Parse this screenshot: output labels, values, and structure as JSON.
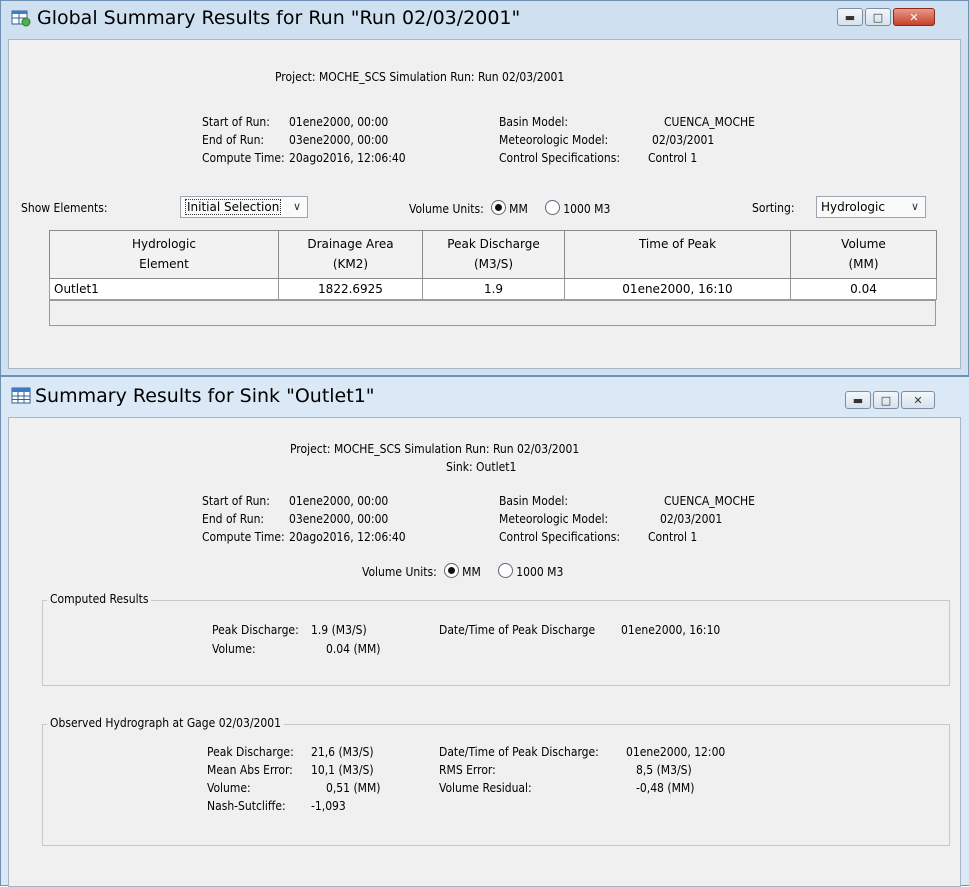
{
  "global": {
    "title": "Global Summary Results for Run \"Run 02/03/2001\"",
    "project_line": "Project: MOCHE_SCS    Simulation Run: Run 02/03/2001",
    "start_of_run_label": "Start of Run:",
    "start_of_run": "01ene2000, 00:00",
    "end_of_run_label": "End of Run:",
    "end_of_run": "03ene2000, 00:00",
    "compute_time_label": "Compute Time:",
    "compute_time": "20ago2016, 12:06:40",
    "basin_model_label": "Basin Model:",
    "basin_model": "CUENCA_MOCHE",
    "met_model_label": "Meteorologic Model:",
    "met_model": "02/03/2001",
    "control_label": "Control Specifications:",
    "control": "Control 1",
    "show_elements_label": "Show Elements:",
    "show_elements_value": "Initial Selection",
    "volume_units_label": "Volume Units:",
    "unit_mm": "MM",
    "unit_1000m3": "1000 M3",
    "sorting_label": "Sorting:",
    "sorting_value": "Hydrologic",
    "table": {
      "headers": [
        [
          "Hydrologic",
          "Element"
        ],
        [
          "Drainage Area",
          "(KM2)"
        ],
        [
          "Peak Discharge",
          "(M3/S)"
        ],
        [
          "Time of Peak",
          ""
        ],
        [
          "Volume",
          "(MM)"
        ]
      ],
      "rows": [
        [
          "Outlet1",
          "1822.6925",
          "1.9",
          "01ene2000, 16:10",
          "0.04"
        ]
      ]
    }
  },
  "sink": {
    "title": "Summary Results for Sink \"Outlet1\"",
    "project_line": "Project: MOCHE_SCS    Simulation Run: Run 02/03/2001",
    "sink_line": "Sink: Outlet1",
    "start_of_run_label": "Start of Run:",
    "start_of_run": "01ene2000, 00:00",
    "end_of_run_label": "End of Run:",
    "end_of_run": "03ene2000, 00:00",
    "compute_time_label": "Compute Time:",
    "compute_time": "20ago2016, 12:06:40",
    "basin_model_label": "Basin Model:",
    "basin_model": "CUENCA_MOCHE",
    "met_model_label": "Meteorologic Model:",
    "met_model": "02/03/2001",
    "control_label": "Control Specifications:",
    "control": "Control 1",
    "volume_units_label": "Volume Units:",
    "unit_mm": "MM",
    "unit_1000m3": "1000 M3",
    "computed": {
      "group_label": "Computed Results",
      "peak_label": "Peak Discharge:",
      "peak_value": "1.9 (M3/S)",
      "volume_label": "Volume:",
      "volume_value": "0.04 (MM)",
      "peak_time_label": "Date/Time of Peak Discharge",
      "peak_time_value": "01ene2000, 16:10"
    },
    "observed": {
      "group_label": "Observed Hydrograph at Gage 02/03/2001",
      "peak_label": "Peak Discharge:",
      "peak_value": "21,6 (M3/S)",
      "mae_label": "Mean Abs Error:",
      "mae_value": "10,1 (M3/S)",
      "volume_label": "Volume:",
      "volume_value": "0,51 (MM)",
      "nash_label": "Nash-Sutcliffe:",
      "nash_value": "-1,093",
      "peak_time_label": "Date/Time of Peak Discharge:",
      "peak_time_value": "01ene2000, 12:00",
      "rms_label": "RMS Error:",
      "rms_value": "8,5 (M3/S)",
      "residual_label": "Volume Residual:",
      "residual_value": "-0,48 (MM)"
    }
  },
  "icons": {
    "global_window_icon": "table-run-icon",
    "sink_window_icon": "table-icon",
    "minimize": "minimize-icon",
    "maximize": "maximize-icon",
    "close": "close-icon"
  },
  "colors": {
    "title_bar": "#cfe0f1",
    "close_button": "#c5402a",
    "client_background": "#f0f0f0"
  }
}
